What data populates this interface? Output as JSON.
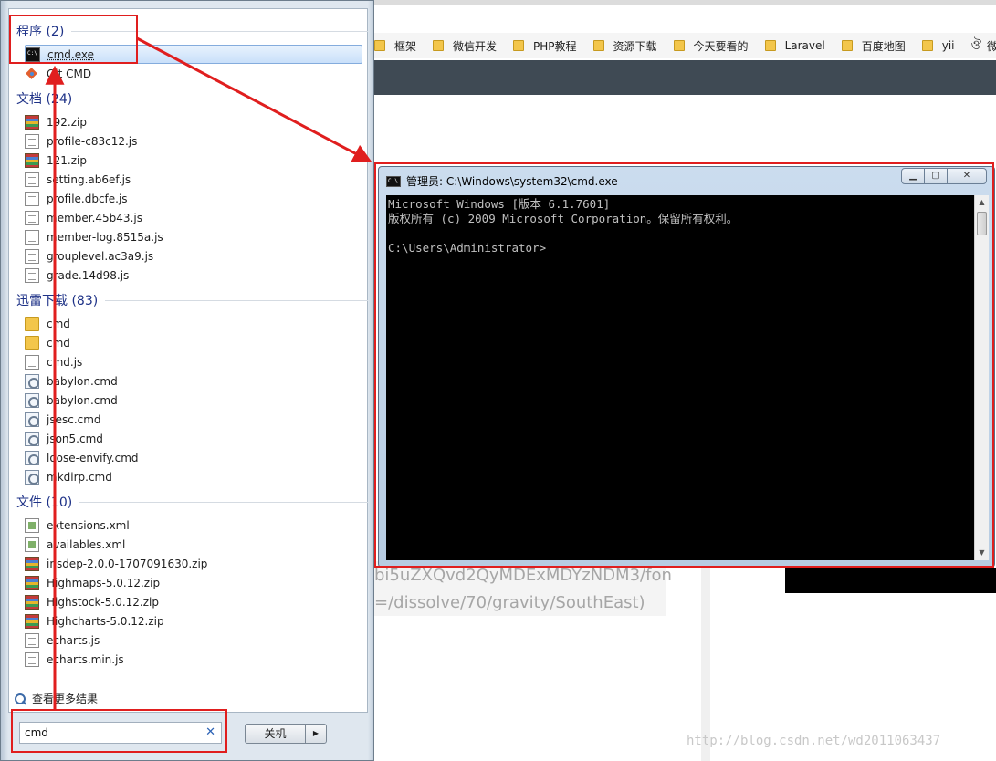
{
  "browser": {
    "bookmarks": [
      "框架",
      "微信开发",
      "PHP教程",
      "资源下载",
      "今天要看的",
      "Laravel",
      "百度地图",
      "yii"
    ],
    "bookmark_last": "微信",
    "bg_text_1": "bi5uZXQvd2QyMDExMDYzNDM3/fon",
    "bg_text_2": "=/dissolve/70/gravity/SouthEast)",
    "watermark": "http://blog.csdn.net/wd2011063437"
  },
  "start_menu": {
    "groups": [
      {
        "label": "程序 (2)",
        "items": [
          {
            "name": "cmd.exe",
            "icon": "cmd-icon",
            "selected": true
          },
          {
            "name": "Git CMD",
            "icon": "git-icon"
          }
        ]
      },
      {
        "label": "文档 (24)",
        "items": [
          {
            "name": "192.zip",
            "icon": "zip-icon"
          },
          {
            "name": "profile-c83c12.js",
            "icon": "js-file-icon"
          },
          {
            "name": "121.zip",
            "icon": "zip-icon"
          },
          {
            "name": "setting.ab6ef.js",
            "icon": "js-file-icon"
          },
          {
            "name": "profile.dbcfe.js",
            "icon": "js-file-icon"
          },
          {
            "name": "member.45b43.js",
            "icon": "js-file-icon"
          },
          {
            "name": "member-log.8515a.js",
            "icon": "js-file-icon"
          },
          {
            "name": "grouplevel.ac3a9.js",
            "icon": "js-file-icon"
          },
          {
            "name": "grade.14d98.js",
            "icon": "js-file-icon"
          }
        ]
      },
      {
        "label": "迅雷下载 (83)",
        "items": [
          {
            "name": "cmd",
            "icon": "folder-icon"
          },
          {
            "name": "cmd",
            "icon": "folder-icon"
          },
          {
            "name": "cmd.js",
            "icon": "js-file-icon"
          },
          {
            "name": "babylon.cmd",
            "icon": "cmd-file-icon"
          },
          {
            "name": "babylon.cmd",
            "icon": "cmd-file-icon"
          },
          {
            "name": "jsesc.cmd",
            "icon": "cmd-file-icon"
          },
          {
            "name": "json5.cmd",
            "icon": "cmd-file-icon"
          },
          {
            "name": "loose-envify.cmd",
            "icon": "cmd-file-icon"
          },
          {
            "name": "mkdirp.cmd",
            "icon": "cmd-file-icon"
          }
        ]
      },
      {
        "label": "文件 (10)",
        "items": [
          {
            "name": "extensions.xml",
            "icon": "xml-file-icon"
          },
          {
            "name": "availables.xml",
            "icon": "xml-file-icon"
          },
          {
            "name": "insdep-2.0.0-1707091630.zip",
            "icon": "zip-icon"
          },
          {
            "name": "Highmaps-5.0.12.zip",
            "icon": "zip-icon"
          },
          {
            "name": "Highstock-5.0.12.zip",
            "icon": "zip-icon"
          },
          {
            "name": "Highcharts-5.0.12.zip",
            "icon": "zip-icon"
          },
          {
            "name": "echarts.js",
            "icon": "js-file-icon"
          },
          {
            "name": "echarts.min.js",
            "icon": "js-file-icon"
          }
        ]
      }
    ],
    "see_more": "查看更多结果",
    "search_value": "cmd",
    "shutdown_label": "关机"
  },
  "cmd_window": {
    "title": "管理员: C:\\Windows\\system32\\cmd.exe",
    "lines": [
      "Microsoft Windows [版本 6.1.7601]",
      "版权所有 (c) 2009 Microsoft Corporation。保留所有权利。",
      "",
      "C:\\Users\\Administrator>"
    ]
  },
  "colors": {
    "annotation": "#e01e1e",
    "group_label": "#1e3287",
    "console_bg": "#000000",
    "console_text": "#c0c0c0"
  }
}
